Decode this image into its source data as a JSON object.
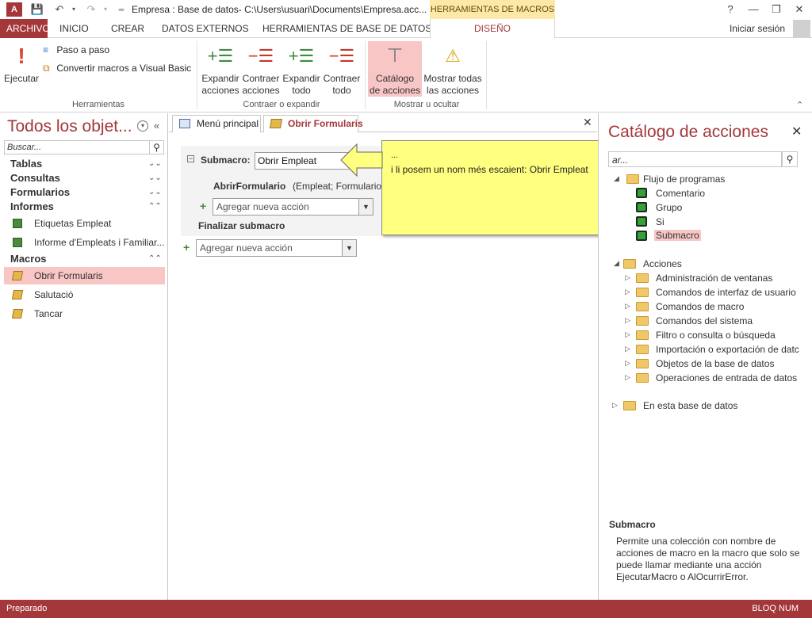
{
  "title_bar": {
    "title": "Empresa : Base de datos- C:\\Users\\usuari\\Documents\\Empresa.acc...",
    "contextual_header": "HERRAMIENTAS DE MACROS",
    "help": "?",
    "minimize": "—",
    "restore": "❐",
    "close": "✕"
  },
  "tabs": {
    "archivo": "ARCHIVO",
    "inicio": "INICIO",
    "crear": "CREAR",
    "datos_externos": "DATOS EXTERNOS",
    "herramientas_bd": "HERRAMIENTAS DE BASE DE DATOS",
    "diseno": "DISEÑO",
    "signin": "Iniciar sesión"
  },
  "ribbon": {
    "ejecutar": "Ejecutar",
    "paso_a_paso": "Paso a paso",
    "convertir": "Convertir macros a Visual Basic",
    "herramientas_group": "Herramientas",
    "expandir_acciones": [
      "Expandir",
      "acciones"
    ],
    "contraer_acciones": [
      "Contraer",
      "acciones"
    ],
    "expandir_todo": [
      "Expandir",
      "todo"
    ],
    "contraer_todo": [
      "Contraer",
      "todo"
    ],
    "contraer_group": "Contraer o expandir",
    "catalogo": [
      "Catálogo",
      "de acciones"
    ],
    "mostrar_todas": [
      "Mostrar todas",
      "las acciones"
    ],
    "mostrar_group": "Mostrar u ocultar"
  },
  "nav": {
    "title": "Todos los objet...",
    "search_placeholder": "Buscar...",
    "categories": {
      "tablas": "Tablas",
      "consultas": "Consultas",
      "formularios": "Formularios",
      "informes": "Informes",
      "macros": "Macros"
    },
    "informes_items": [
      "Etiquetas Empleat",
      "Informe d'Empleats i Familiar..."
    ],
    "macros_items": [
      "Obrir Formularis",
      "Salutació",
      "Tancar"
    ]
  },
  "doc": {
    "tab1": "Menú principal",
    "tab2": "Obrir Formularis",
    "close": "✕",
    "submacro_label": "Submacro:",
    "submacro_value": "Obrir Empleat",
    "action_name": "AbrirFormulario",
    "action_args": "(Empleat; Formulario;",
    "add_action_placeholder": "Agregar nueva acción",
    "end_submacro": "Finalizar submacro",
    "add_action_placeholder_2": "Agregar nueva acción"
  },
  "callout": {
    "dots": "...",
    "text": "i li posem un nom més escaient: Obrir Empleat"
  },
  "catalog": {
    "title": "Catálogo de acciones",
    "close": "✕",
    "search_value": "ar...",
    "flujo": "Flujo de programas",
    "flujo_items": [
      "Comentario",
      "Grupo",
      "Si",
      "Submacro"
    ],
    "acciones": "Acciones",
    "acciones_items": [
      "Administración de ventanas",
      "Comandos de interfaz de usuario",
      "Comandos de macro",
      "Comandos del sistema",
      "Filtro o consulta o búsqueda",
      "Importación o exportación de datc",
      "Objetos de la base de datos",
      "Operaciones de entrada de datos"
    ],
    "en_esta_bd": "En esta base de datos",
    "desc_title": "Submacro",
    "desc": "Permite una colección con nombre de acciones de macro en la macro que solo se puede llamar mediante una acción EjecutarMacro o AlOcurrirError."
  },
  "status": {
    "left": "Preparado",
    "right": "BLOQ NUM"
  },
  "colors": {
    "accent": "#a4373a",
    "highlight": "#f9c6c6",
    "callout": "#ffff80"
  }
}
